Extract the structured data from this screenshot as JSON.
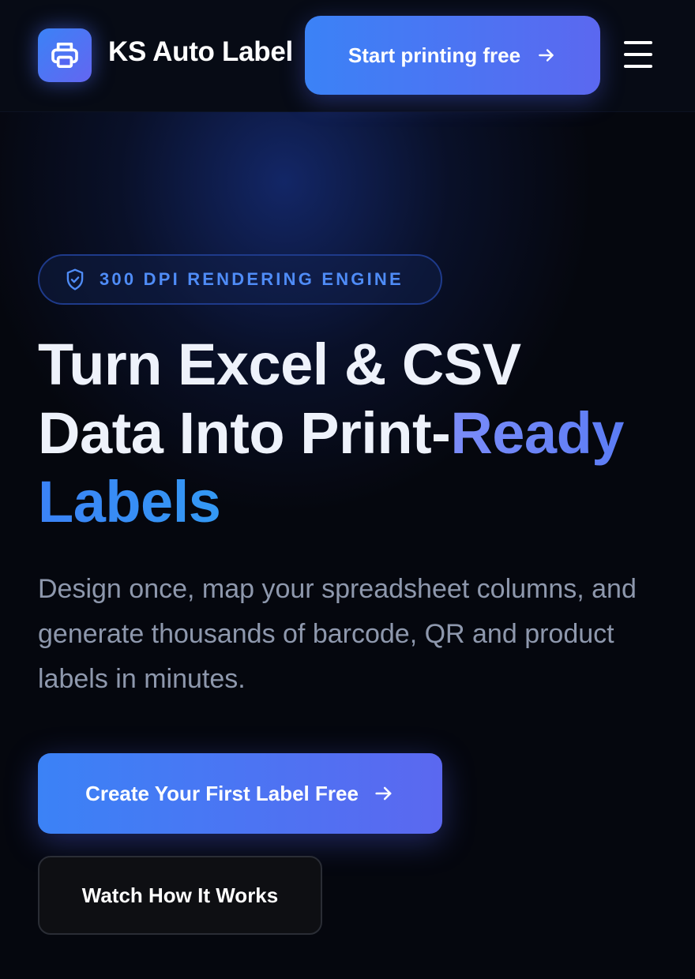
{
  "header": {
    "brand": "KS Auto Label",
    "logo_icon": "printer-icon",
    "cta_label": "Start printing free",
    "cta_icon": "arrow-right-icon",
    "menu_icon": "hamburger-menu-icon"
  },
  "hero": {
    "badge_icon": "shield-check-icon",
    "badge_text": "300 DPI RENDERING ENGINE",
    "headline_line1": "Turn Excel & CSV",
    "headline_line2_plain": "Data Into Print-",
    "headline_line2_accent": "Ready",
    "headline_line3_accent": "Labels",
    "subtitle": "Design once, map your spreadsheet columns, and generate thousands of barcode, QR and product labels in minutes.",
    "primary_cta": "Create Your First Label Free",
    "primary_cta_icon": "arrow-right-icon",
    "secondary_cta": "Watch How It Works"
  },
  "colors": {
    "background": "#05070e",
    "accent_blue": "#3b82f6",
    "accent_indigo": "#6366f1",
    "accent_cyan": "#22d3ee",
    "badge_text": "#4f8cf7",
    "muted_text": "#8e98ad"
  }
}
